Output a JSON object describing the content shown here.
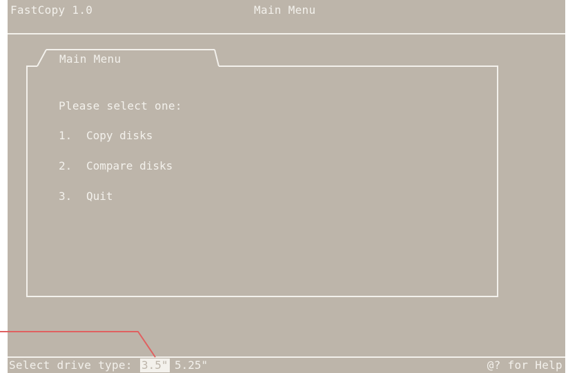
{
  "app": {
    "title": "FastCopy 1.0",
    "screen_title": "Main Menu"
  },
  "window": {
    "tab_title": "Main Menu",
    "prompt": "Please select one:",
    "options": [
      {
        "number": "1.",
        "label": "Copy disks"
      },
      {
        "number": "2.",
        "label": "Compare disks"
      },
      {
        "number": "3.",
        "label": "Quit"
      }
    ]
  },
  "status": {
    "label": "Select drive type:",
    "drive_types": [
      "3.5\"",
      "5.25\""
    ],
    "selected_drive": "3.5\"",
    "help_hint": "@? for Help"
  },
  "colors": {
    "background": "#bdb5aa",
    "foreground": "#f3f1ec",
    "annotation": "#e06060"
  }
}
